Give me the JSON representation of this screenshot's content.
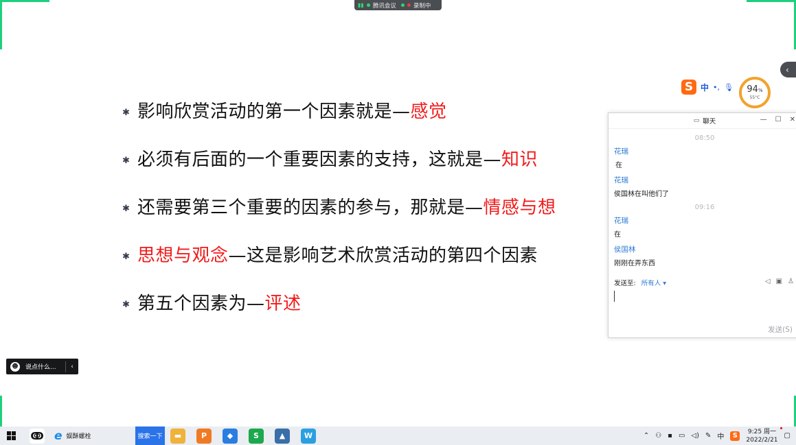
{
  "meeting_bar": {
    "app": "腾讯会议",
    "recording": "录制中"
  },
  "slide": {
    "bullet_mark": "✱",
    "bullets": [
      {
        "text": "影响欣赏活动的第一个因素就是—",
        "highlight": "感觉",
        "highlight_first": false
      },
      {
        "text": "必须有后面的一个重要因素的支持，这就是—",
        "highlight": "知识",
        "highlight_first": false
      },
      {
        "text": "还需要第三个重要的因素的参与，那就是—",
        "highlight": "情感与想",
        "highlight_first": false
      },
      {
        "text": "—这是影响艺术欣赏活动的第四个因素",
        "highlight": "思想与观念",
        "highlight_first": true
      },
      {
        "text": "第五个因素为—",
        "highlight": "评述",
        "highlight_first": false
      }
    ]
  },
  "ime": {
    "logo": "S",
    "lang": "中",
    "punct": "•,",
    "mic": "🎙"
  },
  "gauge": {
    "value": "94",
    "unit": "%",
    "temp": "55°C"
  },
  "chat": {
    "title": "聊天",
    "messages": [
      {
        "time": "08:50",
        "sender": "花瑞",
        "content": "在"
      },
      {
        "time": "",
        "sender": "花瑞",
        "content": "侯国林在叫他们了"
      },
      {
        "time": "09:16",
        "sender": "花瑞",
        "content": "在"
      },
      {
        "time": "",
        "sender": "侯国林",
        "content": "刚刚在弄东西"
      }
    ],
    "send_to_label": "发送至:",
    "send_to_value": "所有人",
    "send_button": "发送(S)"
  },
  "say_box": {
    "placeholder": "说点什么..."
  },
  "taskbar": {
    "ie_label": "娱酥螺栓",
    "search_label": "搜索一下",
    "tray_lang": "中",
    "time": "9:25 周一",
    "date": "2022/2/21"
  },
  "colors": {
    "accent_green": "#1fd07d",
    "highlight_red": "#f21a1a",
    "link_blue": "#2e7ad6"
  }
}
